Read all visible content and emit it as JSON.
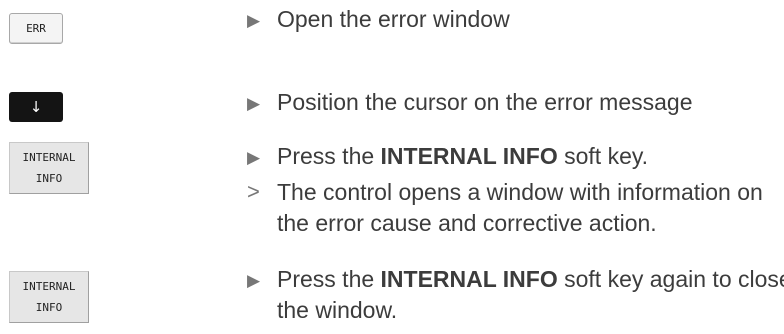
{
  "keys": {
    "err": "ERR",
    "down_arrow": "↓",
    "internal_info_1": {
      "line1": "INTERNAL",
      "line2": "INFO"
    },
    "internal_info_2": {
      "line1": "INTERNAL",
      "line2": "INFO"
    }
  },
  "steps": {
    "open_error_window": "Open the error window",
    "position_cursor": "Position the cursor on the error message",
    "press_internal_info": {
      "pre": "Press the ",
      "bold": "INTERNAL INFO",
      "post": " soft key."
    },
    "result_line1": "The control opens a window with information on",
    "result_line2": "the error cause and corrective action.",
    "press_again": {
      "pre": "Press the ",
      "bold": "INTERNAL INFO",
      "post": " soft key again to close"
    },
    "press_again_line2": "the window."
  },
  "markers": {
    "action": "▶",
    "result": ">"
  }
}
